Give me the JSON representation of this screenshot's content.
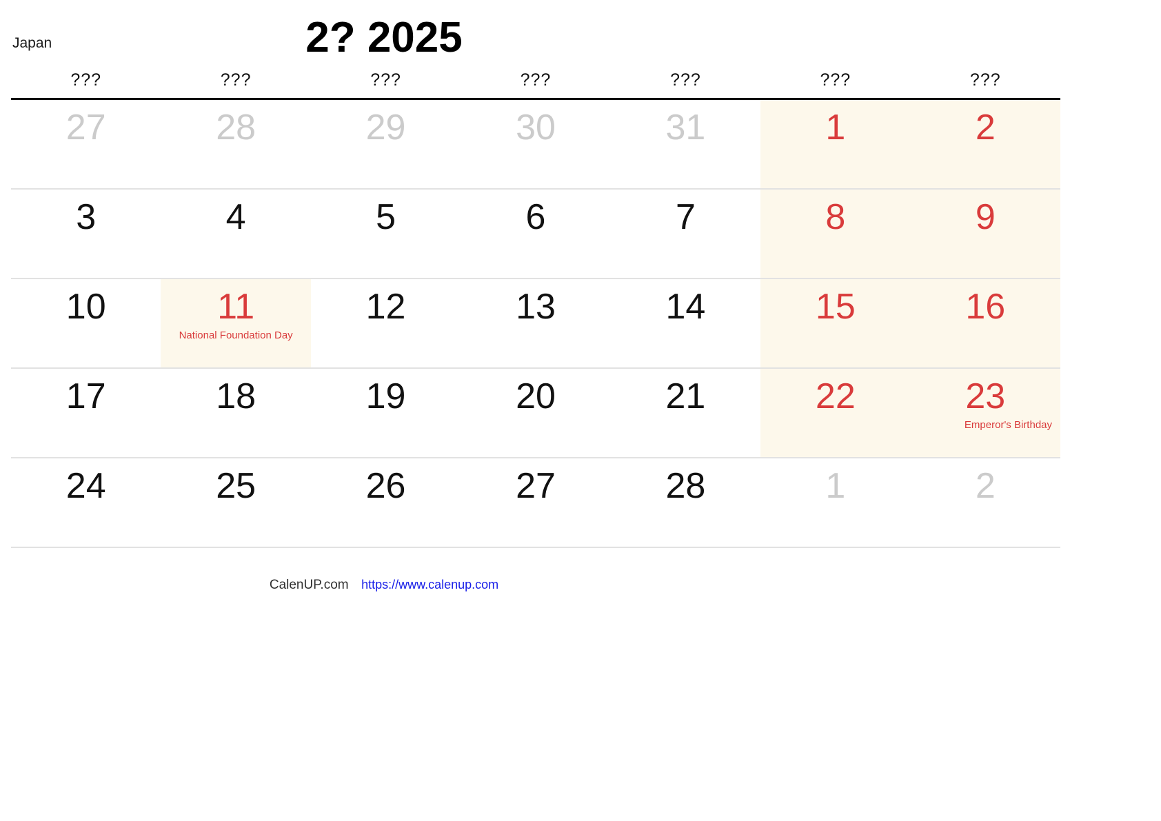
{
  "header": {
    "country": "Japan",
    "title": "2? 2025"
  },
  "weekdays": [
    "???",
    "???",
    "???",
    "???",
    "???",
    "???",
    "???"
  ],
  "colors": {
    "holiday_red": "#d93b3b",
    "muted_gray": "#cbcbcb",
    "weekend_tint": "#fdf8eb",
    "rule_black": "#111111",
    "row_divider": "#e2e2e2",
    "link_blue": "#1a20e8"
  },
  "weeks": [
    [
      {
        "num": "27",
        "style": "muted",
        "tint": "none",
        "holiday": ""
      },
      {
        "num": "28",
        "style": "muted",
        "tint": "none",
        "holiday": ""
      },
      {
        "num": "29",
        "style": "muted",
        "tint": "none",
        "holiday": ""
      },
      {
        "num": "30",
        "style": "muted",
        "tint": "none",
        "holiday": ""
      },
      {
        "num": "31",
        "style": "muted",
        "tint": "none",
        "holiday": ""
      },
      {
        "num": "1",
        "style": "red",
        "tint": "weekend",
        "holiday": ""
      },
      {
        "num": "2",
        "style": "red",
        "tint": "weekend",
        "holiday": ""
      }
    ],
    [
      {
        "num": "3",
        "style": "normal",
        "tint": "none",
        "holiday": ""
      },
      {
        "num": "4",
        "style": "normal",
        "tint": "none",
        "holiday": ""
      },
      {
        "num": "5",
        "style": "normal",
        "tint": "none",
        "holiday": ""
      },
      {
        "num": "6",
        "style": "normal",
        "tint": "none",
        "holiday": ""
      },
      {
        "num": "7",
        "style": "normal",
        "tint": "none",
        "holiday": ""
      },
      {
        "num": "8",
        "style": "red",
        "tint": "weekend",
        "holiday": ""
      },
      {
        "num": "9",
        "style": "red",
        "tint": "weekend",
        "holiday": ""
      }
    ],
    [
      {
        "num": "10",
        "style": "normal",
        "tint": "none",
        "holiday": ""
      },
      {
        "num": "11",
        "style": "red",
        "tint": "holiday",
        "holiday": "National Foundation Day"
      },
      {
        "num": "12",
        "style": "normal",
        "tint": "none",
        "holiday": ""
      },
      {
        "num": "13",
        "style": "normal",
        "tint": "none",
        "holiday": ""
      },
      {
        "num": "14",
        "style": "normal",
        "tint": "none",
        "holiday": ""
      },
      {
        "num": "15",
        "style": "red",
        "tint": "weekend",
        "holiday": ""
      },
      {
        "num": "16",
        "style": "red",
        "tint": "weekend",
        "holiday": ""
      }
    ],
    [
      {
        "num": "17",
        "style": "normal",
        "tint": "none",
        "holiday": ""
      },
      {
        "num": "18",
        "style": "normal",
        "tint": "none",
        "holiday": ""
      },
      {
        "num": "19",
        "style": "normal",
        "tint": "none",
        "holiday": ""
      },
      {
        "num": "20",
        "style": "normal",
        "tint": "none",
        "holiday": ""
      },
      {
        "num": "21",
        "style": "normal",
        "tint": "none",
        "holiday": ""
      },
      {
        "num": "22",
        "style": "red",
        "tint": "weekend",
        "holiday": ""
      },
      {
        "num": "23",
        "style": "red",
        "tint": "weekend",
        "holiday": "Emperor's Birthday"
      }
    ],
    [
      {
        "num": "24",
        "style": "normal",
        "tint": "none",
        "holiday": ""
      },
      {
        "num": "25",
        "style": "normal",
        "tint": "none",
        "holiday": ""
      },
      {
        "num": "26",
        "style": "normal",
        "tint": "none",
        "holiday": ""
      },
      {
        "num": "27",
        "style": "normal",
        "tint": "none",
        "holiday": ""
      },
      {
        "num": "28",
        "style": "normal",
        "tint": "none",
        "holiday": ""
      },
      {
        "num": "1",
        "style": "muted",
        "tint": "none",
        "holiday": ""
      },
      {
        "num": "2",
        "style": "muted",
        "tint": "none",
        "holiday": ""
      }
    ]
  ],
  "footer": {
    "brand": "CalenUP.com",
    "url": "https://www.calenup.com"
  }
}
